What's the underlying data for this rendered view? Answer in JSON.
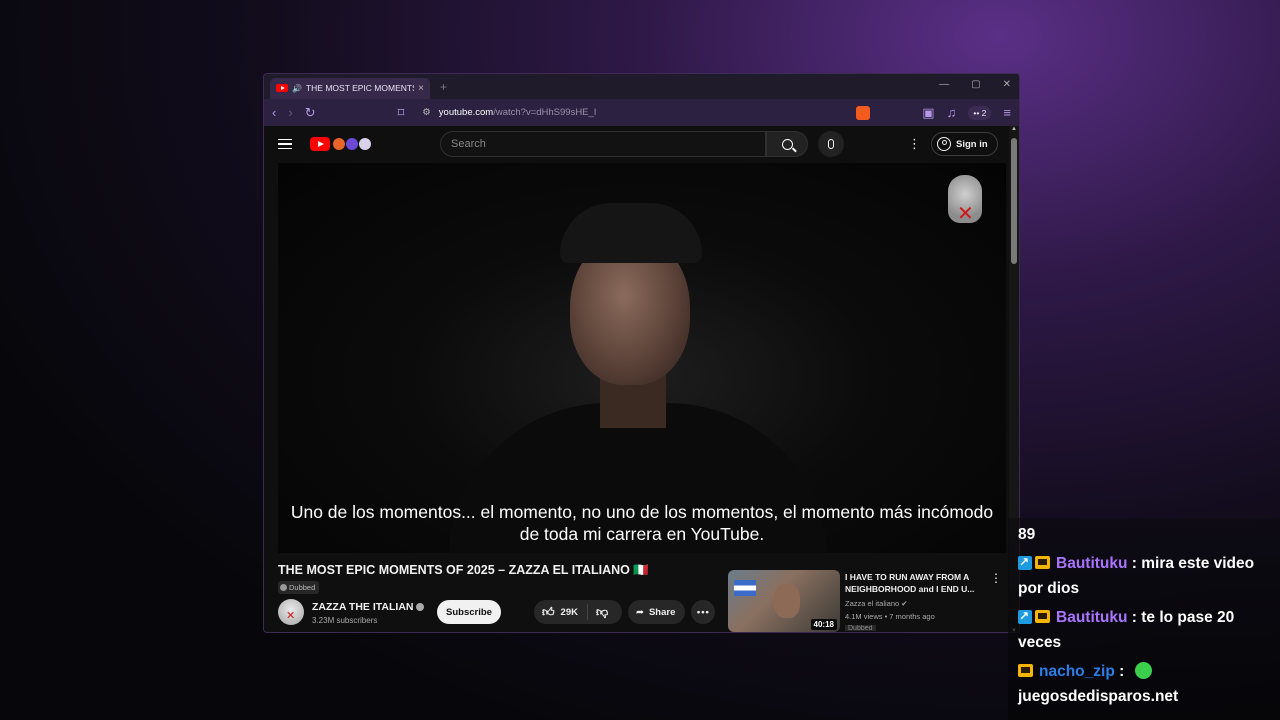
{
  "browser": {
    "tab_title": "THE MOST EPIC MOMENTS O",
    "tab_close": "×",
    "new_tab": "+",
    "win_min": "—",
    "win_max": "▢",
    "win_close": "✕",
    "url_host": "youtube.com",
    "url_path": "/watch?v=dHhS99sHE_I",
    "extensions_count": "2"
  },
  "youtube": {
    "search_placeholder": "Search",
    "sign_in_label": "Sign in",
    "video": {
      "subtitle_line1": "Uno de los momentos... el momento, no uno de los momentos, el momento más incómodo",
      "subtitle_line2": "de toda mi carrera en YouTube."
    },
    "title": "THE MOST EPIC MOMENTS OF 2025 – ZAZZA EL ITALIANO 🇮🇹",
    "dubbed_label": "Dubbed",
    "channel_name": "ZAZZA THE ITALIAN",
    "subscribers": "3.23M subscribers",
    "subscribe_label": "Subscribe",
    "likes": "29K",
    "share_label": "Share",
    "more_label": "•••",
    "recommendation": {
      "title": "I HAVE TO RUN AWAY FROM A NEIGHBORHOOD and I END U...",
      "channel": "Zazza el italiano",
      "meta": "4.1M views • 7 months ago",
      "duration": "40:18",
      "dubbed": "Dubbed"
    }
  },
  "chat": {
    "lines": [
      {
        "user": "",
        "text": "89"
      },
      {
        "user": "Bautituku",
        "text": " : mira este video por dios"
      },
      {
        "user": "Bautituku",
        "text": " : te lo pase 20 veces"
      },
      {
        "user": "nacho_zip",
        "text": " : "
      },
      {
        "user": "",
        "text": "juegosdedisparos.net"
      }
    ]
  },
  "colors": {
    "accent_purple": "#a974ff",
    "accent_blue": "#2b7fe8",
    "youtube_red": "#ff0000"
  }
}
